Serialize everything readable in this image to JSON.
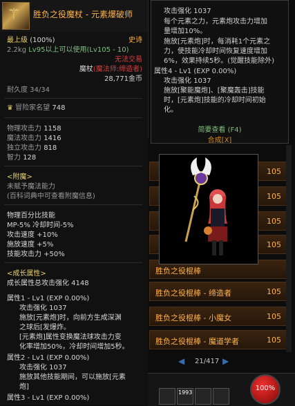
{
  "item": {
    "title": "胜负之役魔杖 - 元素爆破师",
    "grade": "最上级",
    "grade_pct": "(100%)",
    "rarity": "史诗",
    "weight": "2.2kg",
    "level_req": "Lv95以上可以使用(Lv105 - 10)",
    "trade": "无法交易",
    "type": "魔杖",
    "class_req": "(魔法师:缔造者)",
    "price": "28,771金币",
    "durability": "耐久度 34/34",
    "adventure_fame": "冒险家名望",
    "adventure_fame_val": "748",
    "stats": [
      {
        "label": "物理攻击力",
        "value": "1158"
      },
      {
        "label": "魔法攻击力",
        "value": "1416"
      },
      {
        "label": "独立攻击力",
        "value": "818"
      },
      {
        "label": "智力",
        "value": "128"
      }
    ],
    "enchant_header": "<附魔>",
    "enchant_line1": "未赋予魔法能力",
    "enchant_line2": "(百科词典中可查看附魔信息)",
    "skill_pct_header": "物理百分比技能",
    "skill_pct_line": "MP-5% 冷却时间-5%",
    "bonus": [
      "攻击速度 +10%",
      "施放速度 +5%",
      "技能攻击力 +50%"
    ],
    "growth_header": "<成长属性>",
    "growth_total": "成长属性总攻击强化 4148",
    "attr1_title": "属性1 - Lv1 (EXP 0.00%)",
    "attr1_atk": "攻击强化 1037",
    "attr1_desc": [
      "施放[元素炮]时，向前方生成深渊",
      "之球后[发爆炸。",
      "[元素炮]属性变换魔法球攻击力变",
      "化率增加50%，冷却时间增加5秒。"
    ],
    "attr2_title": "属性2 - Lv1 (EXP 0.00%)",
    "attr2_atk": "攻击强化 1037",
    "attr2_desc": [
      "施放其他技能期间，可以施放[元素",
      "炮]"
    ],
    "attr3_title": "属性3 - Lv1 (EXP 0.00%)"
  },
  "skill_tooltip": {
    "lines": [
      "攻击强化 1037",
      "每个元素之力，元素炮攻击力增加",
      "量增加10%。",
      "施放[元素炮]时，每消耗1个元素之",
      "力，使技能冷却时间恢复速度增加",
      "6%，效果持续5秒。(觉醒技能除外)",
      "属性4 - Lv1 (EXP 0.00%)",
      "攻击强化 1037",
      "施放[聚能魔炮]、[聚魔轰击]技能",
      "时，[元素炮]技能的冷却时间初始",
      "化。"
    ],
    "simple_view": "简要查看 (F4)",
    "synthesis": "合成[X]"
  },
  "list": {
    "rows": [
      {
        "name": "胜负之役棍棒 - 缔造者",
        "level": "105"
      },
      {
        "name": "胜负之役棍棒 - 小魔女",
        "level": "105"
      },
      {
        "name": "胜负之役棍棒 - 魔道学者",
        "level": "105"
      }
    ],
    "hidden_level": "105",
    "partial_name": "胜负之役棍棒",
    "page": "21/417"
  },
  "hud": {
    "hp": "100%",
    "slot_count": "1993"
  }
}
